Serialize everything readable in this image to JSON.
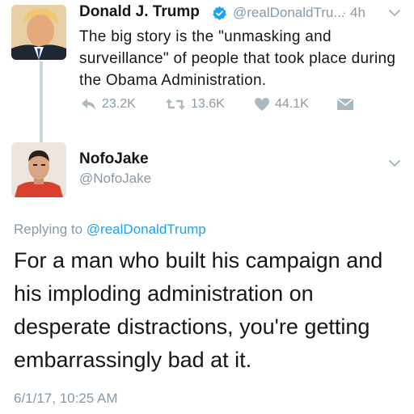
{
  "parent_tweet": {
    "author_name": "Donald J. Trump",
    "handle": "@realDonaldTru...",
    "separator": "·",
    "time": "4h",
    "text": "The big story is the \"unmasking and surveillance\" of people that took place during the Obama Administration.",
    "actions": {
      "reply_count": "23.2K",
      "retweet_count": "13.6K",
      "like_count": "44.1K"
    }
  },
  "reply_tweet": {
    "author_name": "NofoJake",
    "handle": "@NofoJake",
    "replying_prefix": "Replying to",
    "replying_to": "@realDonaldTrump",
    "text": "For a man who built his campaign and his imploding administration on desperate distractions, you're getting embarrassingly bad at it.",
    "timestamp": "6/1/17, 10:25 AM"
  },
  "colors": {
    "text": "#14171a",
    "secondary": "#8899a6",
    "link": "#1da1f2",
    "verified": "#1da1f2",
    "thread_line": "#ccd6dd"
  },
  "icons": [
    "verified-badge-icon",
    "chevron-down-icon",
    "reply-icon",
    "retweet-icon",
    "like-heart-icon",
    "direct-message-icon"
  ]
}
